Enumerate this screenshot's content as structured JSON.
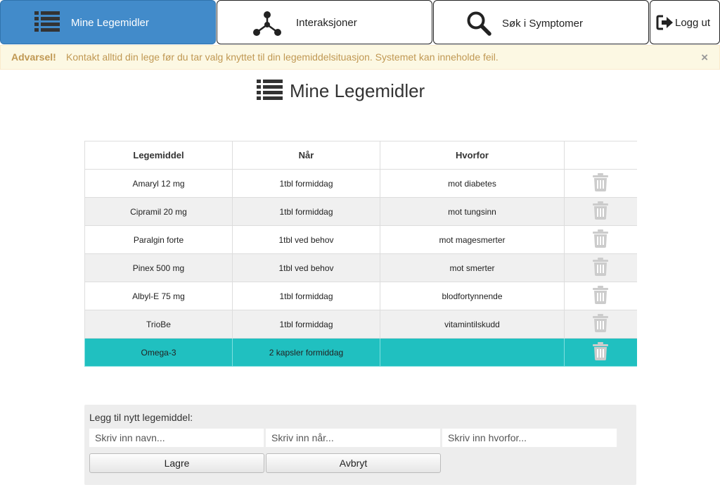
{
  "nav": {
    "items": [
      {
        "label": "Mine Legemidler",
        "icon": "list-icon",
        "active": true
      },
      {
        "label": "Interaksjoner",
        "icon": "network-icon"
      },
      {
        "label": "Søk i Symptomer",
        "icon": "search-icon"
      },
      {
        "label": "Logg ut",
        "icon": "logout-icon"
      }
    ]
  },
  "alert": {
    "strong": "Advarsel!",
    "message": "Kontakt alltid din lege før du tar valg knyttet til din legemiddelsituasjon. Systemet kan inneholde feil.",
    "close": "×"
  },
  "page": {
    "title": "Mine Legemidler"
  },
  "table": {
    "headers": [
      "Legemiddel",
      "Når",
      "Hvorfor",
      ""
    ],
    "rows": [
      {
        "name": "Amaryl 12 mg",
        "when": "1tbl formiddag",
        "why": "mot diabetes"
      },
      {
        "name": "Cipramil 20 mg",
        "when": "1tbl formiddag",
        "why": "mot tungsinn"
      },
      {
        "name": "Paralgin forte",
        "when": "1tbl ved behov",
        "why": "mot magesmerter"
      },
      {
        "name": "Pinex 500 mg",
        "when": "1tbl ved behov",
        "why": "mot smerter"
      },
      {
        "name": "Albyl-E 75 mg",
        "when": "1tbl formiddag",
        "why": "blodfortynnende"
      },
      {
        "name": "TrioBe",
        "when": "1tbl formiddag",
        "why": "vitamintilskudd"
      },
      {
        "name": "Omega-3",
        "when": "2 kapsler formiddag",
        "why": "",
        "selected": true
      }
    ]
  },
  "add_form": {
    "title": "Legg til nytt legemiddel:",
    "name_placeholder": "Skriv inn navn...",
    "when_placeholder": "Skriv inn når...",
    "why_placeholder": "Skriv inn hvorfor...",
    "save_label": "Lagre",
    "cancel_label": "Avbryt"
  },
  "colors": {
    "active_nav": "#428bca",
    "selected_row": "#20c0c0",
    "alert_bg": "#fcf8e3",
    "alert_text": "#c09853"
  }
}
